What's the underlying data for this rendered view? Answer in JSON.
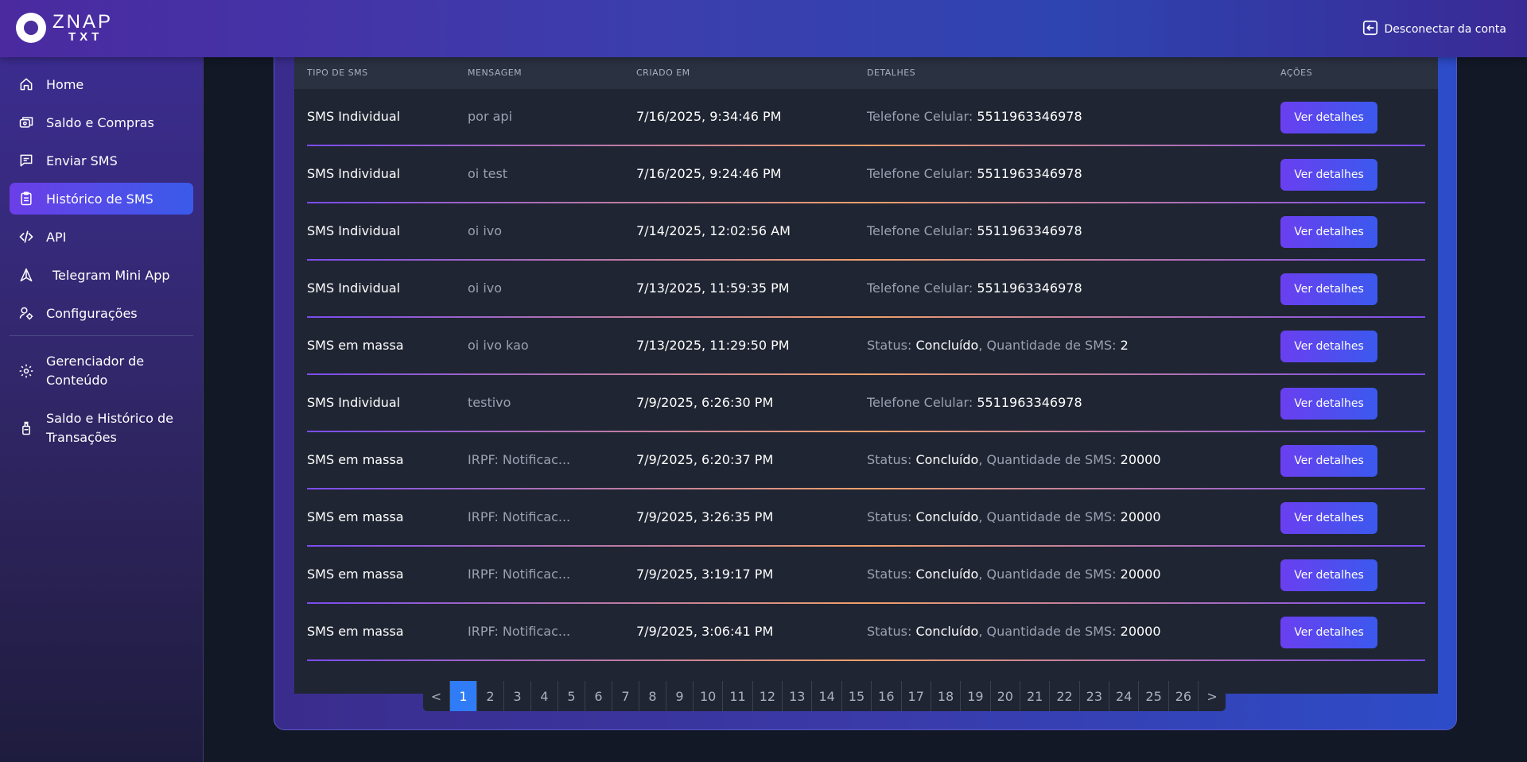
{
  "brand": {
    "line1": "ZNAP",
    "line2": "TXT"
  },
  "header": {
    "logout_label": "Desconectar da conta"
  },
  "sidebar": {
    "items": [
      {
        "label": "Home",
        "icon": "home-icon",
        "active": false
      },
      {
        "label": "Saldo e Compras",
        "icon": "wallet-icon",
        "active": false
      },
      {
        "label": "Enviar SMS",
        "icon": "message-icon",
        "active": false
      },
      {
        "label": "Histórico de SMS",
        "icon": "clipboard-icon",
        "active": true
      },
      {
        "label": "API",
        "icon": "code-icon",
        "active": false
      },
      {
        "label": "Telegram Mini App",
        "icon": "telegram-icon",
        "active": false
      },
      {
        "label": "Configurações",
        "icon": "user-settings-icon",
        "active": false
      }
    ],
    "admin_items": [
      {
        "label": "Gerenciador de Conteúdo",
        "icon": "gear-icon"
      },
      {
        "label": "Saldo e Histórico de Transações",
        "icon": "bottle-icon"
      }
    ]
  },
  "table": {
    "headers": {
      "tipo": "TIPO DE SMS",
      "mensagem": "MENSAGEM",
      "criado": "CRIADO EM",
      "detalhes": "DETALHES",
      "acoes": "AÇÕES"
    },
    "action_label": "Ver detalhes",
    "rows": [
      {
        "tipo": "SMS Individual",
        "mensagem": "por api",
        "criado": "7/16/2025, 9:34:46 PM",
        "d1k": "Telefone Celular: ",
        "d1v": "5511963346978",
        "sep": "",
        "d2k": "",
        "d2v": ""
      },
      {
        "tipo": "SMS Individual",
        "mensagem": "oi test",
        "criado": "7/16/2025, 9:24:46 PM",
        "d1k": "Telefone Celular: ",
        "d1v": "5511963346978",
        "sep": "",
        "d2k": "",
        "d2v": ""
      },
      {
        "tipo": "SMS Individual",
        "mensagem": "oi ivo",
        "criado": "7/14/2025, 12:02:56 AM",
        "d1k": "Telefone Celular: ",
        "d1v": "5511963346978",
        "sep": "",
        "d2k": "",
        "d2v": ""
      },
      {
        "tipo": "SMS Individual",
        "mensagem": "oi ivo",
        "criado": "7/13/2025, 11:59:35 PM",
        "d1k": "Telefone Celular: ",
        "d1v": "5511963346978",
        "sep": "",
        "d2k": "",
        "d2v": ""
      },
      {
        "tipo": "SMS em massa",
        "mensagem": "oi ivo kao",
        "criado": "7/13/2025, 11:29:50 PM",
        "d1k": "Status: ",
        "d1v": "Concluído",
        "sep": ", ",
        "d2k": "Quantidade de SMS: ",
        "d2v": "2"
      },
      {
        "tipo": "SMS Individual",
        "mensagem": "testivo",
        "criado": "7/9/2025, 6:26:30 PM",
        "d1k": "Telefone Celular: ",
        "d1v": "5511963346978",
        "sep": "",
        "d2k": "",
        "d2v": ""
      },
      {
        "tipo": "SMS em massa",
        "mensagem": "IRPF: Notificac...",
        "criado": "7/9/2025, 6:20:37 PM",
        "d1k": "Status: ",
        "d1v": "Concluído",
        "sep": ", ",
        "d2k": "Quantidade de SMS: ",
        "d2v": "20000"
      },
      {
        "tipo": "SMS em massa",
        "mensagem": "IRPF: Notificac...",
        "criado": "7/9/2025, 3:26:35 PM",
        "d1k": "Status: ",
        "d1v": "Concluído",
        "sep": ", ",
        "d2k": "Quantidade de SMS: ",
        "d2v": "20000"
      },
      {
        "tipo": "SMS em massa",
        "mensagem": "IRPF: Notificac...",
        "criado": "7/9/2025, 3:19:17 PM",
        "d1k": "Status: ",
        "d1v": "Concluído",
        "sep": ", ",
        "d2k": "Quantidade de SMS: ",
        "d2v": "20000"
      },
      {
        "tipo": "SMS em massa",
        "mensagem": "IRPF: Notificac...",
        "criado": "7/9/2025, 3:06:41 PM",
        "d1k": "Status: ",
        "d1v": "Concluído",
        "sep": ", ",
        "d2k": "Quantidade de SMS: ",
        "d2v": "20000"
      }
    ]
  },
  "pagination": {
    "prev": "<",
    "next": ">",
    "pages": [
      "1",
      "2",
      "3",
      "4",
      "5",
      "6",
      "7",
      "8",
      "9",
      "10",
      "11",
      "12",
      "13",
      "14",
      "15",
      "16",
      "17",
      "18",
      "19",
      "20",
      "21",
      "22",
      "23",
      "24",
      "25",
      "26"
    ],
    "current": "1"
  },
  "colors": {
    "accent_start": "#6a3ff0",
    "accent_end": "#3b59ee",
    "page_active": "#2f7cf6"
  }
}
